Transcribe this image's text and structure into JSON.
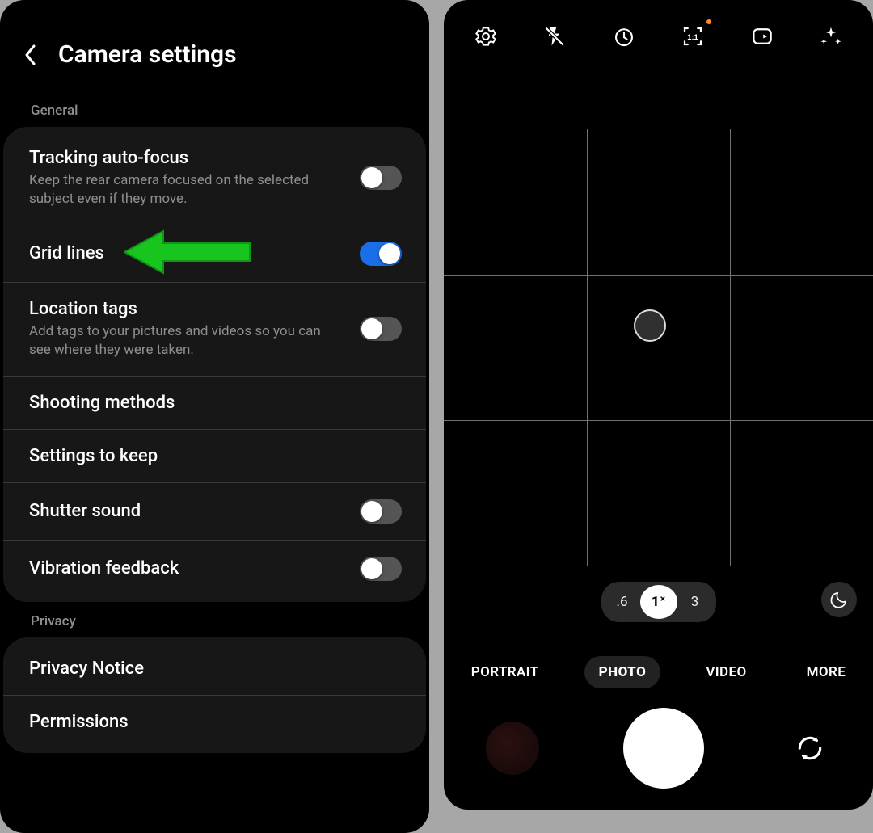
{
  "settings": {
    "title": "Camera settings",
    "section_general": "General",
    "section_privacy": "Privacy",
    "items": {
      "tracking_af": {
        "title": "Tracking auto-focus",
        "desc": "Keep the rear camera focused on the selected subject even if they move."
      },
      "grid_lines": {
        "title": "Grid lines"
      },
      "location_tags": {
        "title": "Location tags",
        "desc": "Add tags to your pictures and videos so you can see where they were taken."
      },
      "shooting_methods": {
        "title": "Shooting methods"
      },
      "settings_to_keep": {
        "title": "Settings to keep"
      },
      "shutter_sound": {
        "title": "Shutter sound"
      },
      "vibration": {
        "title": "Vibration feedback"
      },
      "privacy_notice": {
        "title": "Privacy Notice"
      },
      "permissions": {
        "title": "Permissions"
      }
    }
  },
  "camera": {
    "zoom": {
      "wide": ".6",
      "x1": "1",
      "x1_suffix": "×",
      "tele": "3"
    },
    "modes": {
      "portrait": "PORTRAIT",
      "photo": "PHOTO",
      "video": "VIDEO",
      "more": "MORE"
    }
  }
}
